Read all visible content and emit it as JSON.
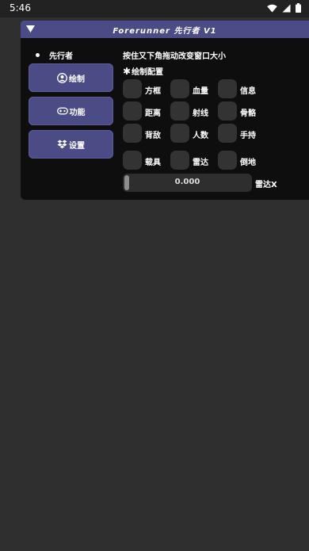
{
  "status_bar": {
    "time": "5:46",
    "icons": [
      "wifi-icon",
      "signal-icon",
      "battery-icon"
    ]
  },
  "window": {
    "title": "Forerunner  先行者  V1",
    "brand": "先行者",
    "nav": [
      {
        "label": "绘制",
        "icon": "user-circle-icon"
      },
      {
        "label": "功能",
        "icon": "gamepad-icon"
      },
      {
        "label": "设置",
        "icon": "dropbox-icon"
      }
    ],
    "hint": "按住又下角拖动改变窗口大小",
    "section_title": "绘制配置",
    "section_icon": "asterisk-icon",
    "checkboxes": [
      {
        "label": "方框",
        "checked": false
      },
      {
        "label": "血量",
        "checked": false
      },
      {
        "label": "信息",
        "checked": false
      },
      {
        "label": "距离",
        "checked": false
      },
      {
        "label": "射线",
        "checked": false
      },
      {
        "label": "骨骼",
        "checked": false
      },
      {
        "label": "背敌",
        "checked": false
      },
      {
        "label": "人数",
        "checked": false
      },
      {
        "label": "手持",
        "checked": false
      },
      {
        "label": "载具",
        "checked": false
      },
      {
        "label": "雷达",
        "checked": false
      },
      {
        "label": "倒地",
        "checked": false
      }
    ],
    "slider": {
      "value": "0.000",
      "label": "雷达X"
    }
  },
  "colors": {
    "accent": "#4b4b86",
    "panel": "#0e0e0e",
    "background": "#2f2f2f",
    "checkbox": "#333333"
  }
}
